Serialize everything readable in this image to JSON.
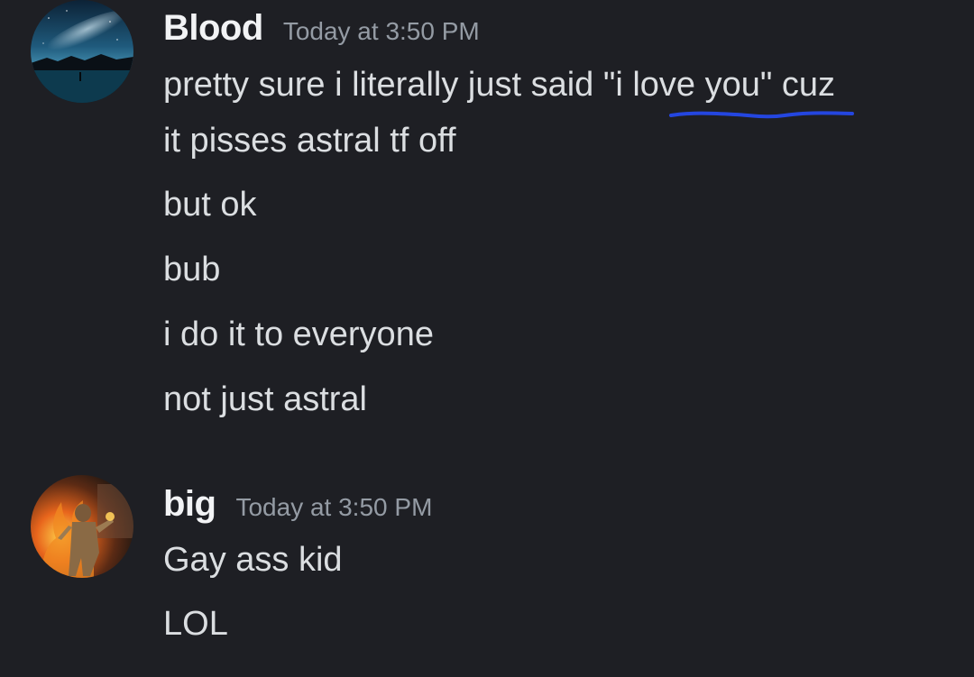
{
  "messages": [
    {
      "author": "Blood",
      "timestamp": "Today at 3:50 PM",
      "avatar_icon": "night-sky-avatar",
      "lines": [
        "pretty sure i literally just said \"i love you\" cuz",
        "it pisses astral tf off",
        "but ok",
        "bub",
        "i do it to everyone",
        "not just astral"
      ]
    },
    {
      "author": "big",
      "timestamp": "Today at 3:50 PM",
      "avatar_icon": "fire-warrior-avatar",
      "lines": [
        "Gay ass kid",
        "LOL"
      ]
    }
  ],
  "colors": {
    "background": "#1e1f24",
    "text": "#dbdee1",
    "username": "#f2f3f5",
    "timestamp": "#949ba4",
    "annotation": "#2446e0"
  }
}
